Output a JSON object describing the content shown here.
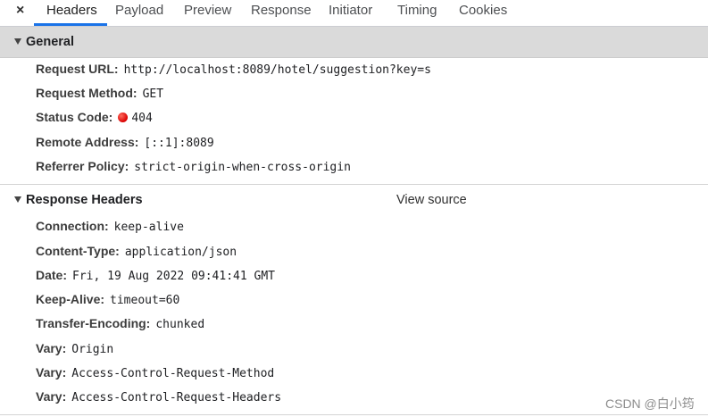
{
  "tabs": {
    "close": "×",
    "items": [
      "Headers",
      "Payload",
      "Preview",
      "Response",
      "Initiator",
      "Timing",
      "Cookies"
    ]
  },
  "general": {
    "title": "General",
    "rows": [
      {
        "key": "Request URL:",
        "value": "http://localhost:8089/hotel/suggestion?key=s"
      },
      {
        "key": "Request Method:",
        "value": "GET"
      },
      {
        "key": "Status Code:",
        "value": "404"
      },
      {
        "key": "Remote Address:",
        "value": "[::1]:8089"
      },
      {
        "key": "Referrer Policy:",
        "value": "strict-origin-when-cross-origin"
      }
    ]
  },
  "response_headers": {
    "title": "Response Headers",
    "view_source": "View source",
    "rows": [
      {
        "key": "Connection:",
        "value": "keep-alive"
      },
      {
        "key": "Content-Type:",
        "value": "application/json"
      },
      {
        "key": "Date:",
        "value": "Fri, 19 Aug 2022 09:41:41 GMT"
      },
      {
        "key": "Keep-Alive:",
        "value": "timeout=60"
      },
      {
        "key": "Transfer-Encoding:",
        "value": "chunked"
      },
      {
        "key": "Vary:",
        "value": "Origin"
      },
      {
        "key": "Vary:",
        "value": "Access-Control-Request-Method"
      },
      {
        "key": "Vary:",
        "value": "Access-Control-Request-Headers"
      }
    ]
  },
  "watermark": "CSDN @白小筠",
  "colors": {
    "active_tab_underline": "#1a73e8",
    "status_error": "#d90000"
  }
}
